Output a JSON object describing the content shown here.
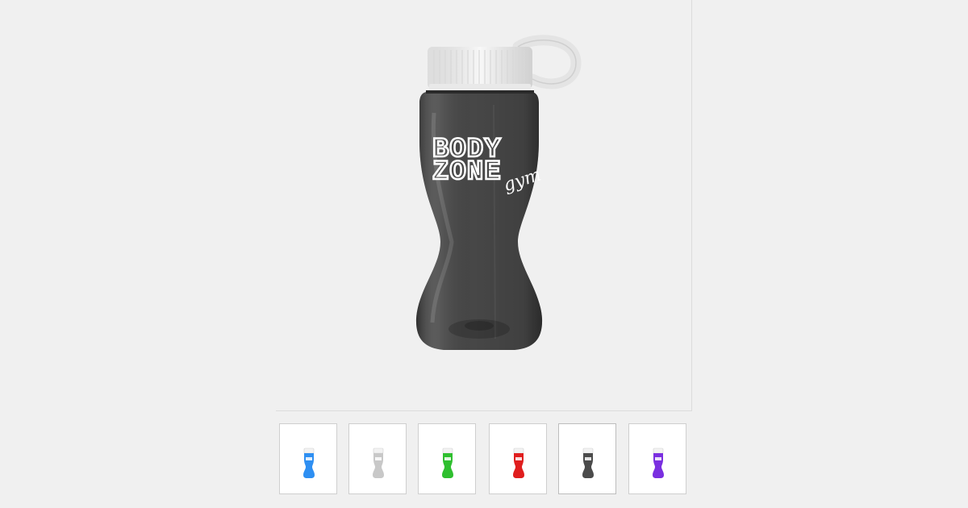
{
  "product": {
    "main_image": {
      "bottle_color": "#474747",
      "bottle_color_name": "smoke",
      "cap_color": "#f6f6f6",
      "imprint_color": "#ffffff",
      "imprint_logo": {
        "line1": "BODY",
        "line2": "ZONE",
        "script": "gym"
      }
    },
    "thumbnails": [
      {
        "color": "#2e8ff2",
        "selected": false
      },
      {
        "color": "#c8c8c8",
        "selected": false
      },
      {
        "color": "#2fbf2f",
        "selected": false
      },
      {
        "color": "#e01e1e",
        "selected": false
      },
      {
        "color": "#4b4b4b",
        "selected": true
      },
      {
        "color": "#7a2fe0",
        "selected": false
      }
    ]
  }
}
